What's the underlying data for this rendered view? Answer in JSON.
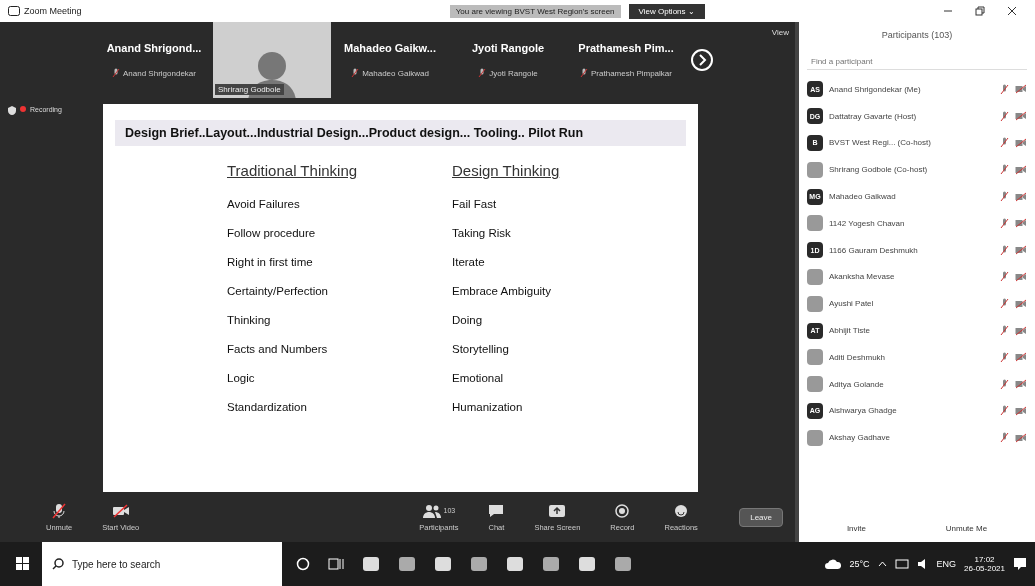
{
  "window": {
    "title": "Zoom Meeting"
  },
  "share_banner": {
    "text": "You are viewing BVST West Region's screen",
    "button": "View Options ⌄"
  },
  "view_button": "View",
  "video_strip": [
    {
      "kind": "name",
      "title": "Anand Shrigond...",
      "label": "Anand Shrigondekar"
    },
    {
      "kind": "video",
      "label": "Shrirang Godbole"
    },
    {
      "kind": "name",
      "title": "Mahadeo Gaikw...",
      "label": "Mahadeo Gaikwad"
    },
    {
      "kind": "name",
      "title": "Jyoti Rangole",
      "label": "Jyoti Rangole"
    },
    {
      "kind": "name",
      "title": "Prathamesh Pim...",
      "label": "Prathamesh Pimpalkar"
    }
  ],
  "recording": "Recording",
  "slide": {
    "title": "Design Brief..Layout...Industrial Design...Product design... Tooling.. Pilot Run",
    "columns": [
      "Traditional Thinking",
      "Design Thinking"
    ],
    "rows": [
      [
        "Avoid Failures",
        "Fail Fast"
      ],
      [
        "Follow procedure",
        "Taking Risk"
      ],
      [
        "Right in first time",
        "Iterate"
      ],
      [
        "Certainty/Perfection",
        "Embrace Ambiguity"
      ],
      [
        "Thinking",
        "Doing"
      ],
      [
        "Facts and Numbers",
        "Storytelling"
      ],
      [
        "Logic",
        "Emotional"
      ],
      [
        "Standardization",
        "Humanization"
      ]
    ]
  },
  "toolbar": [
    {
      "kind": "mic",
      "label": "Unmute"
    },
    {
      "kind": "video",
      "label": "Start Video"
    },
    {
      "kind": "people",
      "label": "Participants",
      "count": "103"
    },
    {
      "kind": "chat",
      "label": "Chat"
    },
    {
      "kind": "share",
      "label": "Share Screen"
    },
    {
      "kind": "record",
      "label": "Record"
    },
    {
      "kind": "reactions",
      "label": "Reactions"
    }
  ],
  "leave_button": "Leave",
  "participants_panel": {
    "title": "Participants (103)",
    "search": {
      "placeholder": "Find a participant"
    },
    "items": [
      {
        "kind": "initials",
        "initials": "AS",
        "name": "Anand Shrigondekar (Me)"
      },
      {
        "kind": "initials",
        "initials": "DG",
        "name": "Dattatray Gavarte (Host)"
      },
      {
        "kind": "initials",
        "initials": "B",
        "name": "BVST West Regi... (Co-host)"
      },
      {
        "kind": "picture",
        "name": "Shrirang Godbole (Co-host)"
      },
      {
        "kind": "initials",
        "initials": "MG",
        "name": "Mahadeo Gaikwad"
      },
      {
        "kind": "picture",
        "name": "1142 Yogesh Chavan"
      },
      {
        "kind": "initials",
        "initials": "1D",
        "name": "1166 Gauram Deshmukh"
      },
      {
        "kind": "picture",
        "name": "Akanksha Mevase"
      },
      {
        "kind": "picture",
        "name": "Ayushi Patel"
      },
      {
        "kind": "initials",
        "initials": "AT",
        "name": "Abhijit Tiste"
      },
      {
        "kind": "picture",
        "name": "Aditi Deshmukh"
      },
      {
        "kind": "picture",
        "name": "Aditya Golande"
      },
      {
        "kind": "initials",
        "initials": "AG",
        "name": "Aishwarya Ghadge"
      },
      {
        "kind": "picture",
        "name": "Akshay Gadhave"
      }
    ],
    "buttons": [
      "Invite",
      "Unmute Me"
    ]
  },
  "taskbar": {
    "search": {
      "placeholder": "Type here to search"
    },
    "weather": "25°C",
    "language": "ENG",
    "time": "17:02",
    "date": "26-05-2021"
  }
}
